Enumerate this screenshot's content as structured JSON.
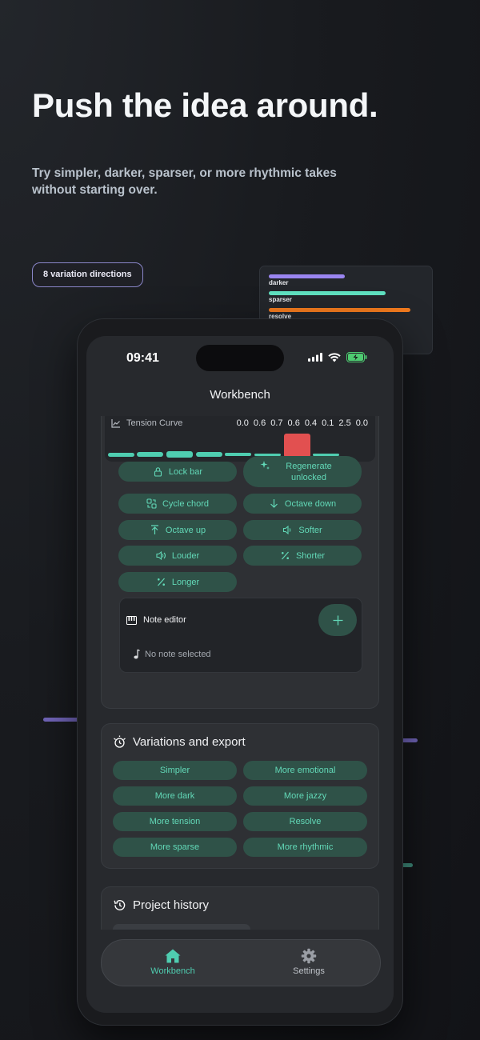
{
  "hero": {
    "title": "Push the idea around.",
    "subtitle": "Try simpler, darker, sparser, or more rhythmic takes without starting over.",
    "badge": "8 variation directions"
  },
  "preview_card": {
    "items": [
      {
        "label": "darker",
        "color": "#9a85f0",
        "level": 0.6
      },
      {
        "label": "sparser",
        "color": "#5fe0c0",
        "level": 0.8
      },
      {
        "label": "resolve",
        "color": "#f17a1e",
        "level": 1.0
      }
    ]
  },
  "status": {
    "time": "09:41"
  },
  "nav": {
    "title": "Workbench"
  },
  "tension": {
    "label": "Tension Curve",
    "values": [
      "0.0",
      "0.6",
      "0.7",
      "0.6",
      "0.4",
      "0.1",
      "2.5",
      "0.0"
    ],
    "selected_index": 6,
    "accent": "#4fcdb0",
    "selected_color": "#e25050"
  },
  "actions": {
    "lock_bar": "Lock bar",
    "regenerate_unlocked": "Regenerate unlocked",
    "cycle_chord": "Cycle chord",
    "octave_down": "Octave down",
    "octave_up": "Octave up",
    "softer": "Softer",
    "louder": "Louder",
    "shorter": "Shorter",
    "longer": "Longer"
  },
  "note_editor": {
    "title": "Note editor",
    "add_icon": "plus-icon",
    "empty": "No note selected"
  },
  "variations": {
    "title": "Variations and export",
    "buttons": [
      "Simpler",
      "More emotional",
      "More dark",
      "More jazzy",
      "More tension",
      "Resolve",
      "More sparse",
      "More rhythmic"
    ]
  },
  "history": {
    "title": "Project history"
  },
  "tabs": [
    {
      "label": "Workbench",
      "icon": "home-icon",
      "active": true
    },
    {
      "label": "Settings",
      "icon": "gear-icon",
      "active": false
    }
  ],
  "colors": {
    "accent": "#4fcdb0",
    "button_bg": "#2f5248",
    "button_text": "#62d8b7"
  }
}
